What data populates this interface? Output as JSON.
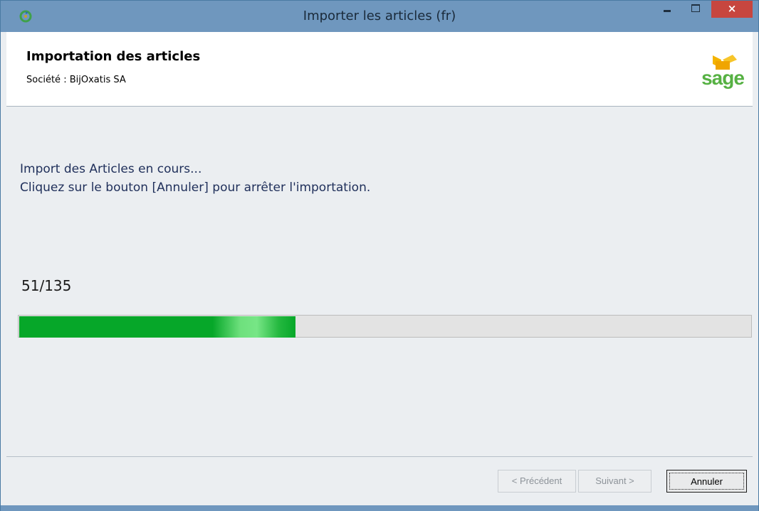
{
  "window": {
    "title": "Importer les articles (fr)",
    "close_glyph": "×"
  },
  "header": {
    "title": "Importation des articles",
    "subtitle": "Société : BijOxatis SA",
    "logo_text": "sage"
  },
  "content": {
    "message_line1": "Import des Articles en cours...",
    "message_line2": "Cliquez sur le bouton [Annuler] pour arrêter l'importation.",
    "progress_label": "51/135",
    "progress": {
      "current": 51,
      "total": 135
    }
  },
  "footer": {
    "prev_label": "< Précédent",
    "next_label": "Suivant >",
    "cancel_label": "Annuler"
  },
  "colors": {
    "accent": "#6f97be",
    "progress": "#06a729",
    "logo": "#56b143"
  },
  "icons": [
    "app-refresh-icon",
    "minimize-icon",
    "maximize-icon",
    "close-icon",
    "sage-logo"
  ]
}
